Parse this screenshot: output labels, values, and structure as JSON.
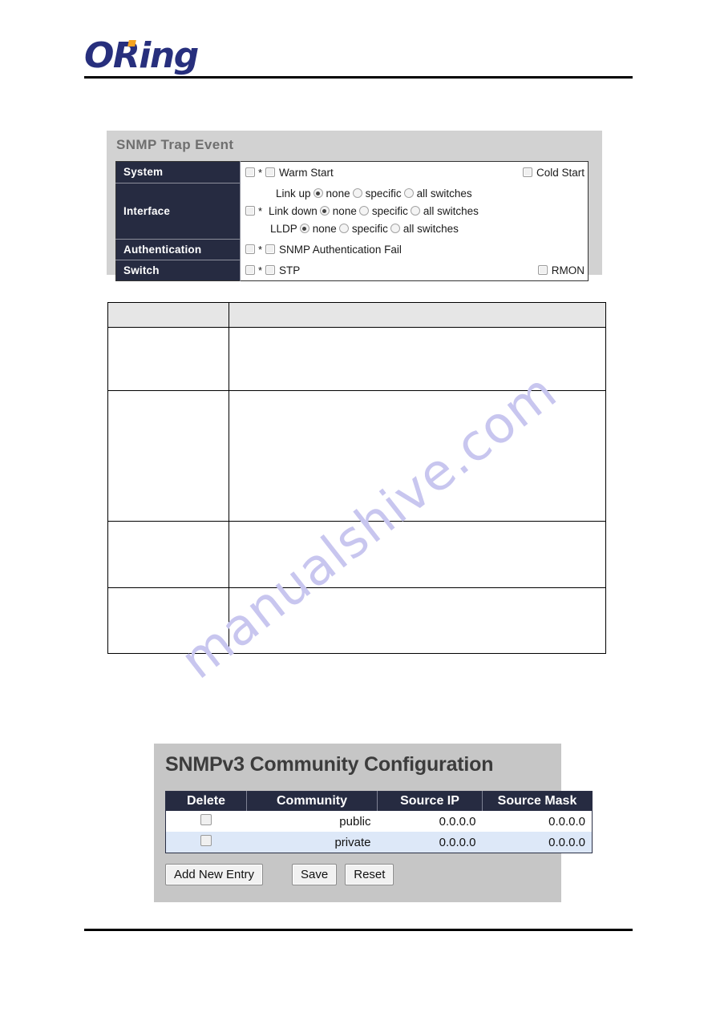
{
  "header": {
    "brand_name": "ORing",
    "brand_color": "#272f7d",
    "accent_color": "#f5a320"
  },
  "watermark": {
    "text": "manualshive.com",
    "color": "#c8c6ef"
  },
  "trap_panel": {
    "title": "SNMP Trap Event",
    "categories": {
      "system": "System",
      "interface": "Interface",
      "authentication": "Authentication",
      "switch": "Switch"
    },
    "asterisk": "*",
    "system_row": {
      "warm_start": "Warm Start",
      "cold_start": "Cold Start"
    },
    "interface_row": {
      "link_up": "Link up",
      "link_down": "Link down",
      "lldp": "LLDP",
      "option_none": "none",
      "option_specific": "specific",
      "option_all": "all switches",
      "link_up_selected": "none",
      "link_down_selected": "none",
      "lldp_selected": "none"
    },
    "authentication_row": {
      "snmp_auth_fail": "SNMP Authentication Fail"
    },
    "switch_row": {
      "stp": "STP",
      "rmon": "RMON"
    }
  },
  "snmpv3_panel": {
    "title": "SNMPv3 Community Configuration",
    "columns": [
      "Delete",
      "Community",
      "Source IP",
      "Source Mask"
    ],
    "rows": [
      {
        "community": "public",
        "source_ip": "0.0.0.0",
        "source_mask": "0.0.0.0"
      },
      {
        "community": "private",
        "source_ip": "0.0.0.0",
        "source_mask": "0.0.0.0"
      }
    ],
    "buttons": {
      "add_new_entry": "Add New Entry",
      "save": "Save",
      "reset": "Reset"
    }
  }
}
